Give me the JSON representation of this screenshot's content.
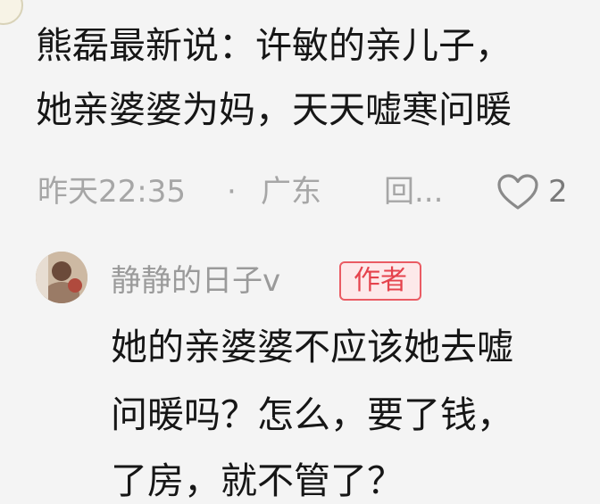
{
  "comment": {
    "line1": "熊磊最新说：许敏的亲儿子，",
    "line2": "她亲婆婆为妈，天天嘘寒问暖",
    "time": "昨天22:35",
    "separator": "·",
    "location": "广东",
    "reply_label": "回...",
    "like_count": "2"
  },
  "reply": {
    "username": "静静的日子v",
    "badge": "作者",
    "line1": "她的亲婆婆不应该她去嘘",
    "line2": "问暖吗？怎么，要了钱，",
    "line3": "了房，就不管了？"
  },
  "icons": {
    "like": "heart-outline-icon"
  },
  "colors": {
    "background": "#f4f4f4",
    "badge_red": "#e5434d",
    "meta_gray": "#a6a6a6"
  }
}
